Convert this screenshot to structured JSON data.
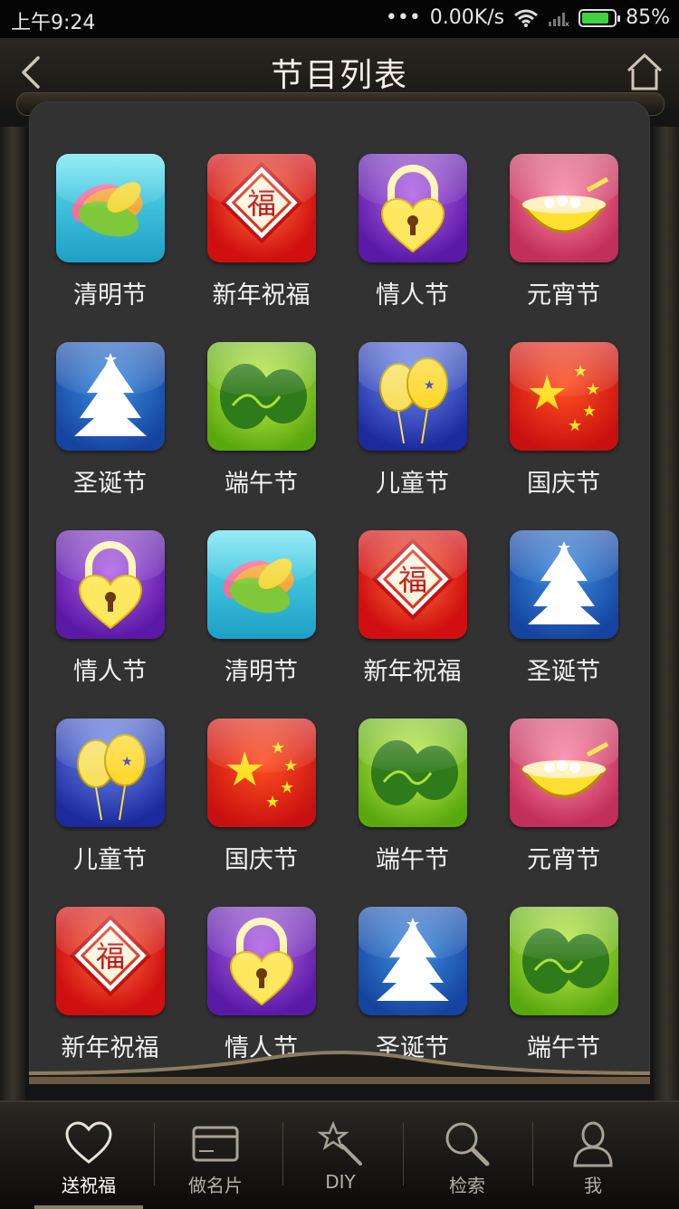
{
  "status_bar": {
    "time": "上午9:24",
    "network_speed": "0.00K/s",
    "battery": "85%",
    "battery_level": 0.85
  },
  "header": {
    "title": "节目列表",
    "back_icon": "chevron-left-icon",
    "home_icon": "home-icon"
  },
  "festivals": [
    {
      "label": "清明节",
      "theme": "qingming"
    },
    {
      "label": "新年祝福",
      "theme": "xinnian"
    },
    {
      "label": "情人节",
      "theme": "qingren"
    },
    {
      "label": "元宵节",
      "theme": "yuanxiao"
    },
    {
      "label": "圣诞节",
      "theme": "shengdan"
    },
    {
      "label": "端午节",
      "theme": "duanwu"
    },
    {
      "label": "儿童节",
      "theme": "ertong"
    },
    {
      "label": "国庆节",
      "theme": "guoqing"
    },
    {
      "label": "情人节",
      "theme": "qingren"
    },
    {
      "label": "清明节",
      "theme": "qingming"
    },
    {
      "label": "新年祝福",
      "theme": "xinnian"
    },
    {
      "label": "圣诞节",
      "theme": "shengdan"
    },
    {
      "label": "儿童节",
      "theme": "ertong"
    },
    {
      "label": "国庆节",
      "theme": "guoqing"
    },
    {
      "label": "端午节",
      "theme": "duanwu"
    },
    {
      "label": "元宵节",
      "theme": "yuanxiao"
    },
    {
      "label": "新年祝福",
      "theme": "xinnian"
    },
    {
      "label": "情人节",
      "theme": "qingren"
    },
    {
      "label": "圣诞节",
      "theme": "shengdan"
    },
    {
      "label": "端午节",
      "theme": "duanwu"
    }
  ],
  "tabs": [
    {
      "label": "送祝福",
      "icon": "heart-icon",
      "active": true
    },
    {
      "label": "做名片",
      "icon": "card-icon",
      "active": false
    },
    {
      "label": "DIY",
      "icon": "magic-wand-icon",
      "active": false
    },
    {
      "label": "检索",
      "icon": "search-icon",
      "active": false
    },
    {
      "label": "我",
      "icon": "user-icon",
      "active": false
    }
  ],
  "colors": {
    "panel": "#333232",
    "background": "#141414",
    "active_tab_label": "#ffffff",
    "tab_label": "#b5afa6"
  }
}
